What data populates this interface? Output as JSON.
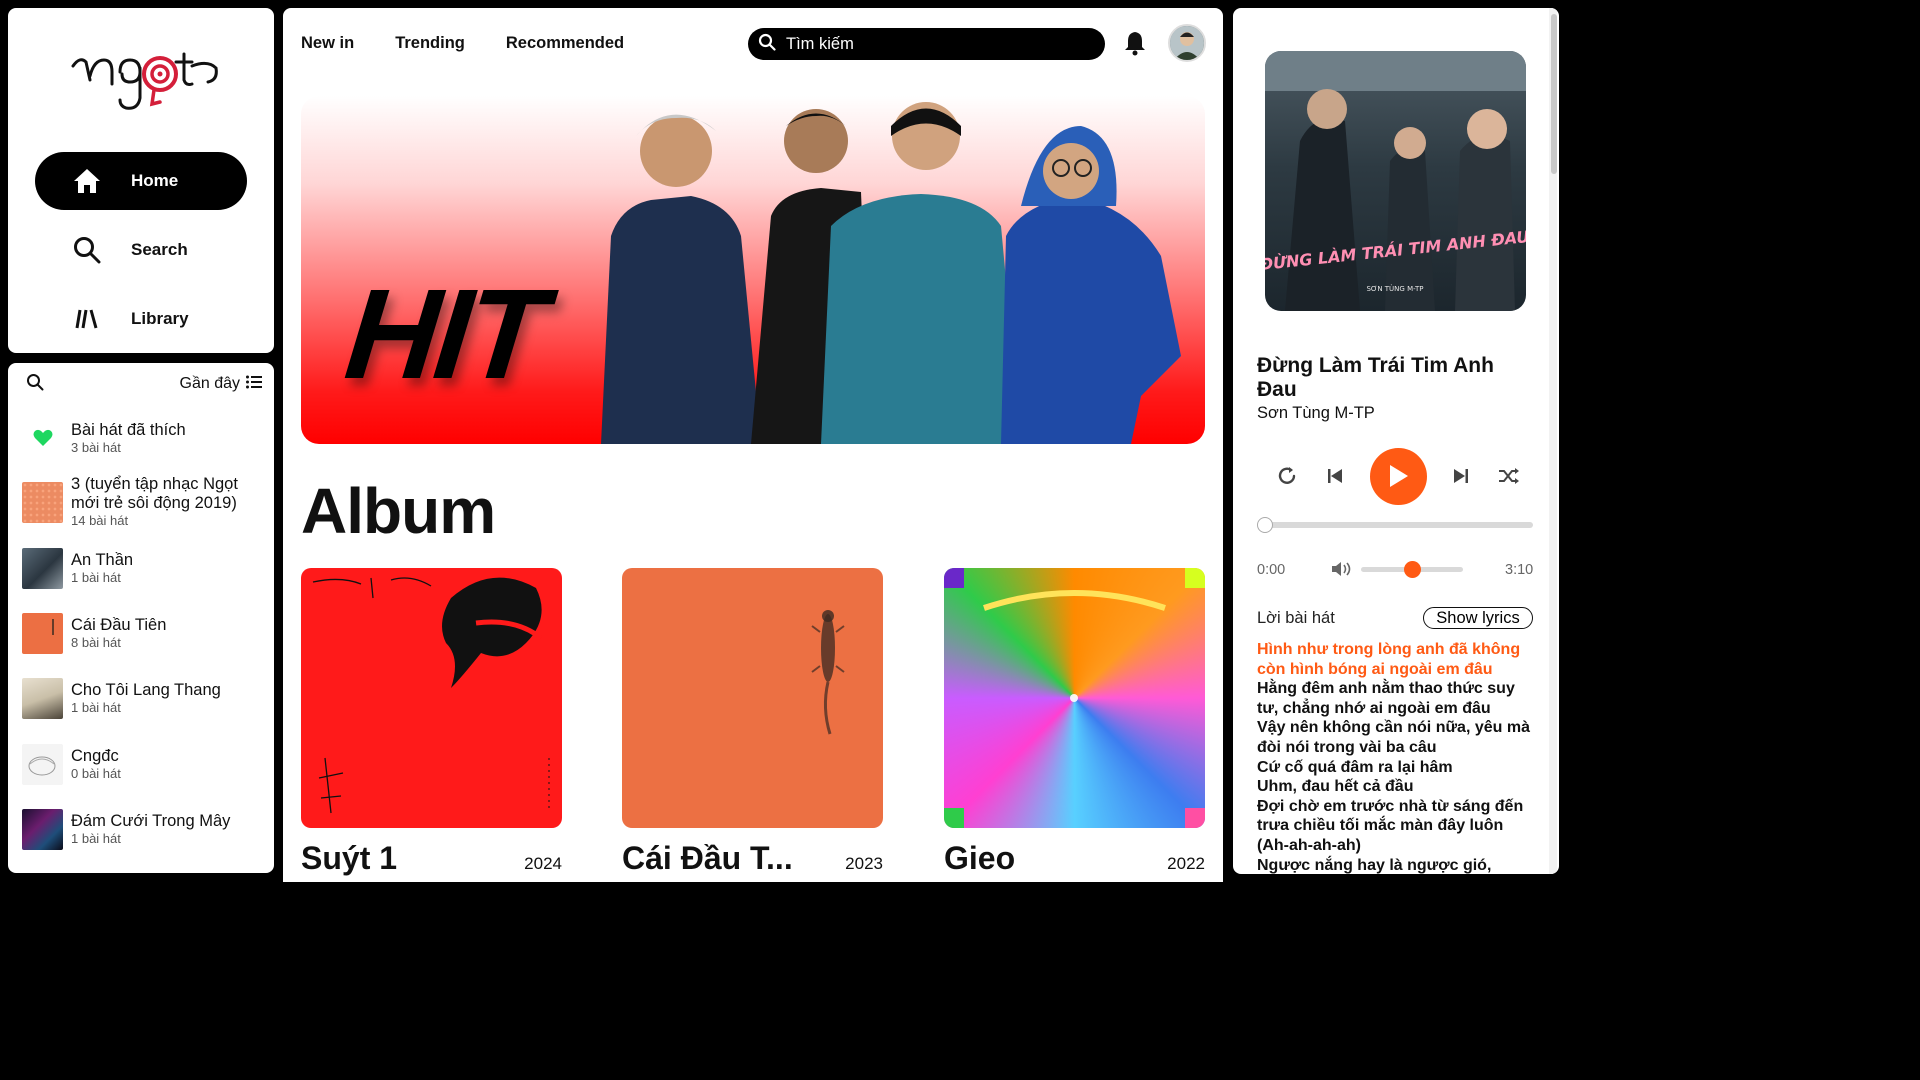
{
  "brand": {
    "logo_text": "ngọt",
    "accent": "#ff5a14",
    "logo_red": "#d41f3a"
  },
  "nav": {
    "items": [
      {
        "label": "Home",
        "icon": "home-icon",
        "active": true
      },
      {
        "label": "Search",
        "icon": "search-icon",
        "active": false
      },
      {
        "label": "Library",
        "icon": "library-icon",
        "active": false
      }
    ]
  },
  "library": {
    "sort_label": "Gần đây",
    "items": [
      {
        "title": "Bài hát đã thích",
        "count": "3 bài hát",
        "thumb": "heart-icon"
      },
      {
        "title": "3 (tuyển tập nhạc Ngọt mới trẻ sôi động 2019)",
        "count": "14 bài hát",
        "thumb": "album-3"
      },
      {
        "title": "An Thần",
        "count": "1 bài hát",
        "thumb": "album-an-than"
      },
      {
        "title": "Cái Đầu Tiên",
        "count": "8 bài hát",
        "thumb": "album-cai-dau-tien"
      },
      {
        "title": "Cho Tôi Lang Thang",
        "count": "1 bài hát",
        "thumb": "album-cho-toi-lang-thang"
      },
      {
        "title": "Cngđc",
        "count": "0 bài hát",
        "thumb": "album-cngdc"
      },
      {
        "title": "Đám Cưới Trong Mây",
        "count": "1 bài hát",
        "thumb": "album-dam-cuoi"
      }
    ]
  },
  "header": {
    "tabs": [
      "New in",
      "Trending",
      "Recommended"
    ],
    "search_placeholder": "Tìm kiếm"
  },
  "hero": {
    "word": "HIT"
  },
  "albums": {
    "heading": "Album",
    "items": [
      {
        "name": "Suýt 1",
        "year": "2024"
      },
      {
        "name": "Cái Đầu T...",
        "year": "2023"
      },
      {
        "name": "Gieo",
        "year": "2022"
      }
    ]
  },
  "player": {
    "cover_text": "ĐỪNG LÀM TRÁI TIM ANH ĐAU",
    "cover_artist": "SƠN TÙNG M-TP",
    "title": "Đừng Làm Trái Tim Anh Đau",
    "artist": "Sơn Tùng M-TP",
    "time_current": "0:00",
    "time_total": "3:10",
    "progress": 0,
    "volume": 0.5,
    "lyrics_label": "Lời bài hát",
    "show_lyrics_label": "Show lyrics",
    "lyrics": [
      {
        "text": "Hình như trong lòng anh đã không còn hình bóng ai ngoài em đâu",
        "current": true
      },
      {
        "text": "Hằng đêm anh nằm thao thức suy tư, chẳng nhớ ai ngoài em đâu",
        "current": false
      },
      {
        "text": "Vậy nên không cần nói nữa, yêu mà đòi nói trong vài ba câu",
        "current": false
      },
      {
        "text": "Cứ cố quá đâm ra lại hâm",
        "current": false
      },
      {
        "text": "Uhm, đau hết cả đầu",
        "current": false
      },
      {
        "text": "Đợi chờ em trước nhà từ sáng đến trưa chiều tối mắc màn đây luôn",
        "current": false
      },
      {
        "text": "(Ah-ah-ah-ah)",
        "current": false
      },
      {
        "text": "Ngược nắng hay là ngược gió,",
        "current": false
      }
    ]
  }
}
